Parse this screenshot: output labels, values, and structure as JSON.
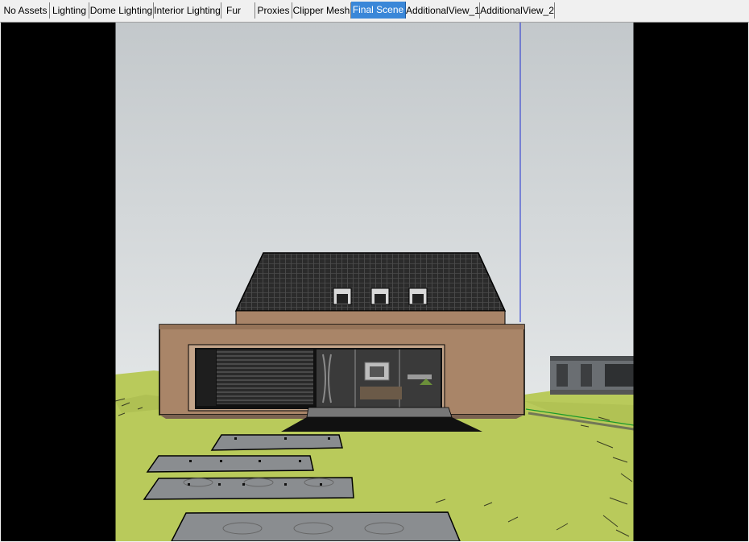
{
  "tabs": [
    {
      "label": "No Assets",
      "active": false
    },
    {
      "label": "Lighting",
      "active": false
    },
    {
      "label": "Dome Lighting",
      "active": false
    },
    {
      "label": "Interior Lighting",
      "active": false
    },
    {
      "label": "Fur",
      "active": false
    },
    {
      "label": "Proxies",
      "active": false
    },
    {
      "label": "Clipper Mesh",
      "active": false
    },
    {
      "label": "Final Scene",
      "active": true
    },
    {
      "label": "AdditionalView_1",
      "active": false
    },
    {
      "label": "AdditionalView_2",
      "active": false
    }
  ],
  "colors": {
    "active_tab": "#3a87d8",
    "grass": "#b8c95a",
    "wall": "#a88468",
    "roof": "#2a2a2a",
    "stone": "#8a8d90",
    "sky_top": "#c4c9cc",
    "sky_bottom": "#e6e9ea"
  }
}
